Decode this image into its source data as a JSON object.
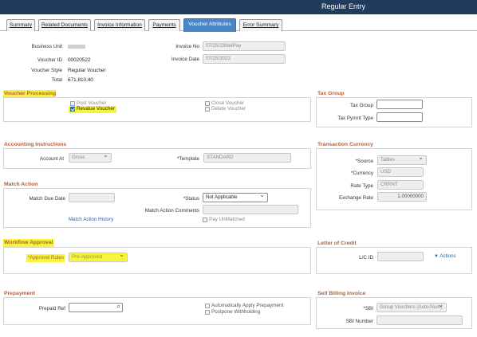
{
  "header": {
    "title": "Regular Entry"
  },
  "tabs": [
    {
      "label": "Summary"
    },
    {
      "label": "Related Documents"
    },
    {
      "label": "Invoice Information"
    },
    {
      "label": "Payments"
    },
    {
      "label": "Voucher Attributes"
    },
    {
      "label": "Error Summary"
    }
  ],
  "summary": {
    "business_unit_label": "Business Unit",
    "voucher_id_label": "Voucher ID",
    "voucher_id": "00020522",
    "voucher_style_label": "Voucher Style",
    "voucher_style": "Regular Voucher",
    "total_label": "Total",
    "total": "671,810.40",
    "invoice_no_label": "Invoice No",
    "invoice_no": "07/25/23NetPay",
    "invoice_date_label": "Invoice Date",
    "invoice_date": "07/25/2023"
  },
  "voucher_processing": {
    "title": "Voucher Processing",
    "post_voucher": "Post Voucher",
    "revalue_voucher": "Revalue Voucher",
    "close_voucher": "Close Voucher",
    "delete_voucher": "Delete Voucher"
  },
  "tax_group": {
    "title": "Tax Group",
    "tax_group_label": "Tax Group",
    "tax_pymnt_type_label": "Tax Pymnt Type"
  },
  "accounting": {
    "title": "Accounting Instructions",
    "account_at_label": "Account At",
    "account_at": "Gross",
    "template_label": "*Template",
    "template": "STANDARD"
  },
  "currency": {
    "title": "Transaction Currency",
    "source_label": "*Source",
    "source": "Tables",
    "currency_label": "*Currency",
    "currency": "USD",
    "rate_type_label": "Rate Type",
    "rate_type": "CRRNT",
    "exchange_rate_label": "Exchange Rate",
    "exchange_rate": "1.00000000"
  },
  "match_action": {
    "title": "Match Action",
    "match_due_date_label": "Match Due Date",
    "status_label": "*Status",
    "status": "Not Applicable",
    "match_action_comments_label": "Match Action Comments",
    "match_action_history": "Match Action History",
    "pay_unmatched": "Pay UnMatched"
  },
  "workflow": {
    "title": "Workflow Approval",
    "approval_rules_label": "*Approval Rules",
    "approval_rules": "Pre-Approved"
  },
  "letter_of_credit": {
    "title": "Letter of Credit",
    "lc_id_label": "L/C ID",
    "actions": "Actions"
  },
  "prepayment": {
    "title": "Prepayment",
    "prepaid_ref_label": "Prepaid Ref",
    "auto_apply": "Automatically Apply Prepayment",
    "postpone": "Postpone Withholding"
  },
  "self_billing": {
    "title": "Self Billing Invoice",
    "sbi_label": "*SBI",
    "sbi": "Group Vouchers (Auto-Num)",
    "sbi_number_label": "SBI Number"
  },
  "colors": {
    "header_bg": "#1f3b5d",
    "active_tab": "#4a87c7",
    "section_title": "#b2613a",
    "highlight": "#f6f53a",
    "link": "#2b63a8"
  }
}
